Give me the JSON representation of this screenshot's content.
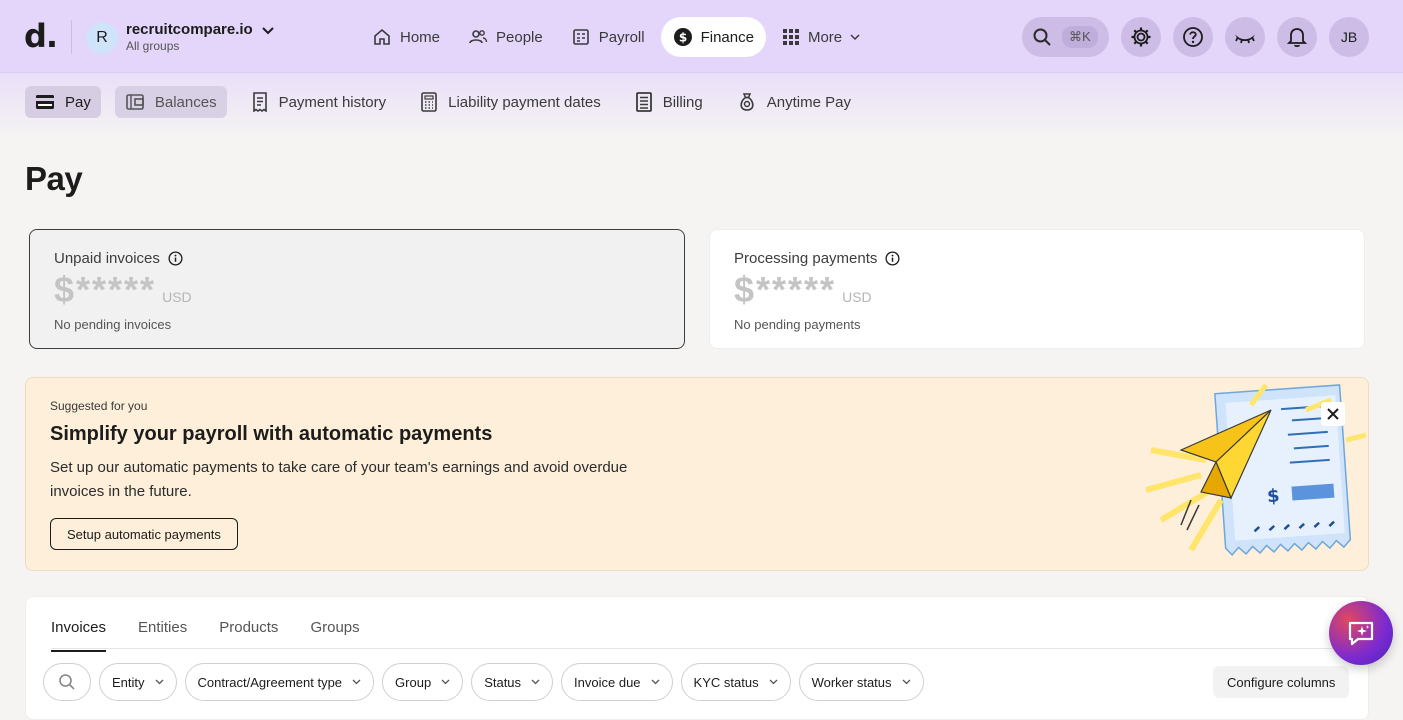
{
  "logo": "d.",
  "org": {
    "initial": "R",
    "name": "recruitcompare.io",
    "subtitle": "All groups"
  },
  "nav": {
    "items": [
      {
        "label": "Home",
        "icon": "home-icon"
      },
      {
        "label": "People",
        "icon": "people-icon"
      },
      {
        "label": "Payroll",
        "icon": "payroll-icon"
      },
      {
        "label": "Finance",
        "icon": "dollar-icon",
        "active": true
      },
      {
        "label": "More",
        "icon": "grid-icon"
      }
    ]
  },
  "tools": {
    "search_shortcut": "⌘K",
    "user_initials": "JB"
  },
  "subnav": {
    "items": [
      {
        "label": "Pay",
        "icon": "card-icon",
        "active": true
      },
      {
        "label": "Balances",
        "icon": "wallet-icon"
      },
      {
        "label": "Payment history",
        "icon": "receipt-icon"
      },
      {
        "label": "Liability payment dates",
        "icon": "calculator-icon"
      },
      {
        "label": "Billing",
        "icon": "billing-icon"
      },
      {
        "label": "Anytime Pay",
        "icon": "money-bag-icon"
      }
    ]
  },
  "page": {
    "title": "Pay"
  },
  "cards": {
    "unpaid": {
      "label": "Unpaid invoices",
      "amount": "$*****",
      "currency": "USD",
      "note": "No pending invoices"
    },
    "processing": {
      "label": "Processing payments",
      "amount": "$*****",
      "currency": "USD",
      "note": "No pending payments"
    }
  },
  "promo": {
    "eyebrow": "Suggested for you",
    "title": "Simplify your payroll with automatic payments",
    "body": "Set up our automatic payments to take care of your team's earnings and avoid overdue invoices in the future.",
    "button": "Setup automatic payments"
  },
  "table": {
    "tabs": [
      "Invoices",
      "Entities",
      "Products",
      "Groups"
    ],
    "filters": [
      "Entity",
      "Contract/Agreement type",
      "Group",
      "Status",
      "Invoice due",
      "KYC status",
      "Worker status"
    ],
    "configure": "Configure columns"
  },
  "colors": {
    "header_bg": "#e4d6fb",
    "promo_bg": "#fdefd9",
    "accent": "#7b2ad1"
  }
}
